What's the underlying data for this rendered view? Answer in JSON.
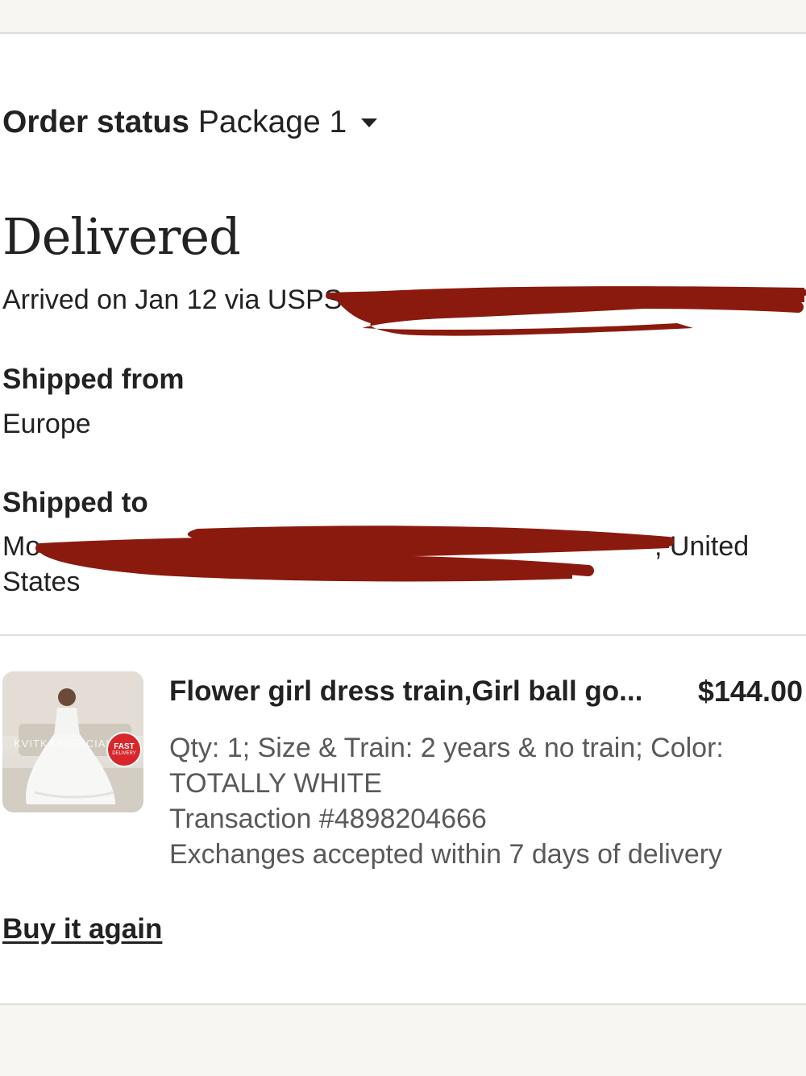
{
  "header": {
    "title": "Order status",
    "package_label": "Package 1",
    "dropdown_icon": "caret-down-icon"
  },
  "status": {
    "headline": "Delivered",
    "arrival": "Arrived on Jan 12 via USPS"
  },
  "shipped_from": {
    "label": "Shipped from",
    "value": "Europe"
  },
  "shipped_to": {
    "label": "Shipped to",
    "line1_start": "Mo",
    "line1_end": ", United",
    "line2": "States"
  },
  "item": {
    "title": "Flower girl dress train,Girl ball go...",
    "price": "$144.00",
    "options": "Qty: 1; Size & Train: 2 years & no train; Color: TOTALLY WHITE",
    "transaction": "Transaction #4898204666",
    "exchanges": "Exchanges accepted within 7 days of delivery",
    "image_watermark": "KVITKA OFFICIAL",
    "badge_top": "FAST",
    "badge_bottom": "DELIVERY"
  },
  "actions": {
    "buy_again": "Buy it again"
  },
  "colors": {
    "text": "#222222",
    "secondary_text": "#595959",
    "redaction": "#8b1a0e",
    "bar_background": "#f7f6f3",
    "badge": "#d8262c"
  }
}
